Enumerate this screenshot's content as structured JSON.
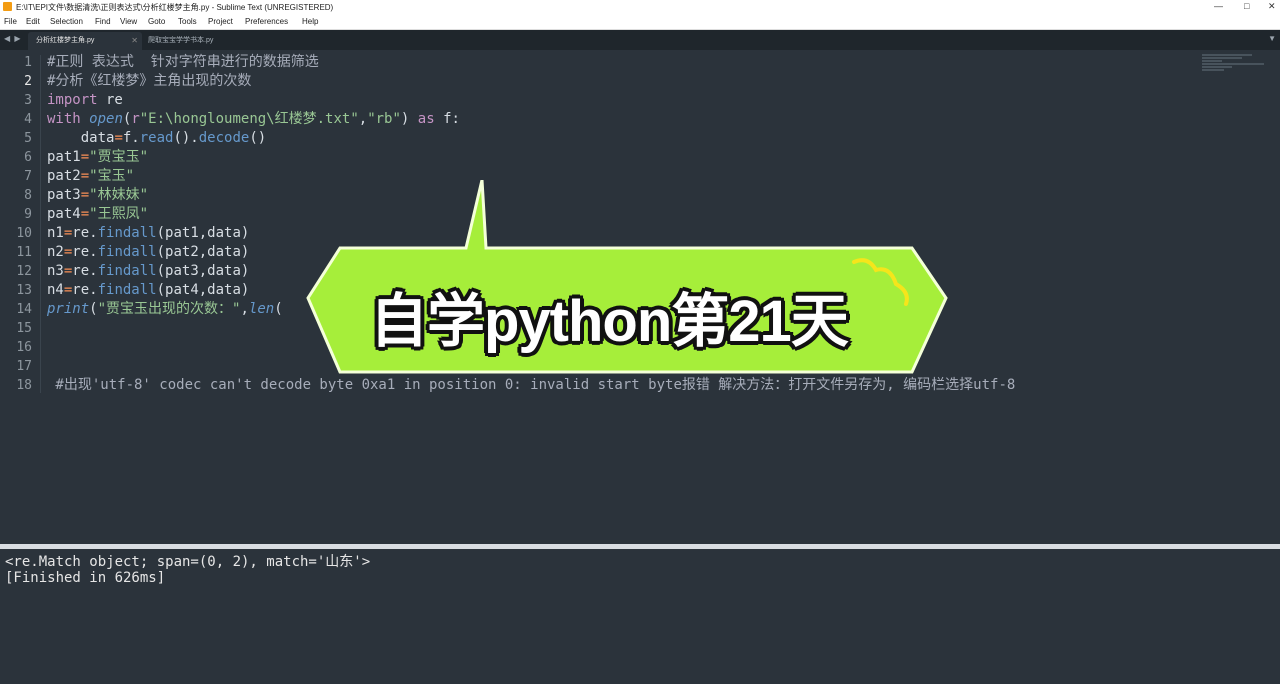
{
  "window": {
    "title": "E:\\IT\\EPI文件\\数据清洗\\正则表达式\\分析红楼梦主角.py - Sublime Text (UNREGISTERED)",
    "minimize": "—",
    "maximize": "□",
    "close": "✕"
  },
  "menu": [
    "File",
    "Edit",
    "Selection",
    "Find",
    "View",
    "Goto",
    "Tools",
    "Project",
    "Preferences",
    "Help"
  ],
  "tabs": [
    {
      "label": "分析红楼梦主角.py",
      "active": true
    },
    {
      "label": "爬取宝宝学学书本.py",
      "active": false
    }
  ],
  "tab_nav": "◀ ▶",
  "tab_dropdown": "▼",
  "code_lines": [
    {
      "n": "1",
      "parts": [
        {
          "t": "#正则 表达式  针对字符串进行的数据筛选",
          "c": "cm"
        }
      ]
    },
    {
      "n": "2",
      "parts": [
        {
          "t": "#分析《红楼梦》主角出现的次数",
          "c": "cm"
        }
      ]
    },
    {
      "n": "3",
      "parts": [
        {
          "t": "import",
          "c": "kw"
        },
        {
          "t": " re",
          "c": "pl"
        }
      ]
    },
    {
      "n": "4",
      "parts": [
        {
          "t": "with",
          "c": "kw"
        },
        {
          "t": " ",
          "c": "pl"
        },
        {
          "t": "open",
          "c": "it"
        },
        {
          "t": "(",
          "c": "pl"
        },
        {
          "t": "r",
          "c": "kw"
        },
        {
          "t": "\"E:\\hongloumeng\\红楼梦.txt\"",
          "c": "st"
        },
        {
          "t": ",",
          "c": "pl"
        },
        {
          "t": "\"rb\"",
          "c": "st"
        },
        {
          "t": ") ",
          "c": "pl"
        },
        {
          "t": "as",
          "c": "kw"
        },
        {
          "t": " f:",
          "c": "pl"
        }
      ]
    },
    {
      "n": "5",
      "parts": [
        {
          "t": "    data",
          "c": "pl"
        },
        {
          "t": "=",
          "c": "op"
        },
        {
          "t": "f.",
          "c": "pl"
        },
        {
          "t": "read",
          "c": "fn"
        },
        {
          "t": "().",
          "c": "pl"
        },
        {
          "t": "decode",
          "c": "fn"
        },
        {
          "t": "()",
          "c": "pl"
        }
      ]
    },
    {
      "n": "6",
      "parts": [
        {
          "t": "pat1",
          "c": "pl"
        },
        {
          "t": "=",
          "c": "op"
        },
        {
          "t": "\"贾宝玉\"",
          "c": "st"
        }
      ]
    },
    {
      "n": "7",
      "parts": [
        {
          "t": "pat2",
          "c": "pl"
        },
        {
          "t": "=",
          "c": "op"
        },
        {
          "t": "\"宝玉\"",
          "c": "st"
        }
      ]
    },
    {
      "n": "8",
      "parts": [
        {
          "t": "pat3",
          "c": "pl"
        },
        {
          "t": "=",
          "c": "op"
        },
        {
          "t": "\"林妹妹\"",
          "c": "st"
        }
      ]
    },
    {
      "n": "9",
      "parts": [
        {
          "t": "pat4",
          "c": "pl"
        },
        {
          "t": "=",
          "c": "op"
        },
        {
          "t": "\"王熙凤\"",
          "c": "st"
        }
      ]
    },
    {
      "n": "10",
      "parts": [
        {
          "t": "n1",
          "c": "pl"
        },
        {
          "t": "=",
          "c": "op"
        },
        {
          "t": "re.",
          "c": "pl"
        },
        {
          "t": "findall",
          "c": "fn"
        },
        {
          "t": "(pat1,data)",
          "c": "pl"
        }
      ]
    },
    {
      "n": "11",
      "parts": [
        {
          "t": "n2",
          "c": "pl"
        },
        {
          "t": "=",
          "c": "op"
        },
        {
          "t": "re.",
          "c": "pl"
        },
        {
          "t": "findall",
          "c": "fn"
        },
        {
          "t": "(pat2,data)",
          "c": "pl"
        }
      ]
    },
    {
      "n": "12",
      "parts": [
        {
          "t": "n3",
          "c": "pl"
        },
        {
          "t": "=",
          "c": "op"
        },
        {
          "t": "re.",
          "c": "pl"
        },
        {
          "t": "findall",
          "c": "fn"
        },
        {
          "t": "(pat3,data)",
          "c": "pl"
        }
      ]
    },
    {
      "n": "13",
      "parts": [
        {
          "t": "n4",
          "c": "pl"
        },
        {
          "t": "=",
          "c": "op"
        },
        {
          "t": "re.",
          "c": "pl"
        },
        {
          "t": "findall",
          "c": "fn"
        },
        {
          "t": "(pat4,data)",
          "c": "pl"
        }
      ]
    },
    {
      "n": "14",
      "parts": [
        {
          "t": "print",
          "c": "it"
        },
        {
          "t": "(",
          "c": "pl"
        },
        {
          "t": "\"贾宝玉出现的次数：\"",
          "c": "st"
        },
        {
          "t": ",",
          "c": "pl"
        },
        {
          "t": "len",
          "c": "it"
        },
        {
          "t": "(",
          "c": "pl"
        }
      ]
    },
    {
      "n": "15",
      "parts": []
    },
    {
      "n": "16",
      "parts": []
    },
    {
      "n": "17",
      "parts": []
    },
    {
      "n": "18",
      "parts": [
        {
          "t": " #出现'utf-8' codec can't decode byte 0xa1 in position 0: invalid start byte报错 解决方法：打开文件另存为, 编码栏选择utf-8",
          "c": "cm"
        }
      ]
    }
  ],
  "current_line": "2",
  "output_lines": [
    "<re.Match object; span=(0, 2), match='山东'>",
    "[Finished in 626ms]"
  ],
  "overlay": {
    "text": "自学python第21天",
    "bubble_color": "#a6ee3a"
  }
}
